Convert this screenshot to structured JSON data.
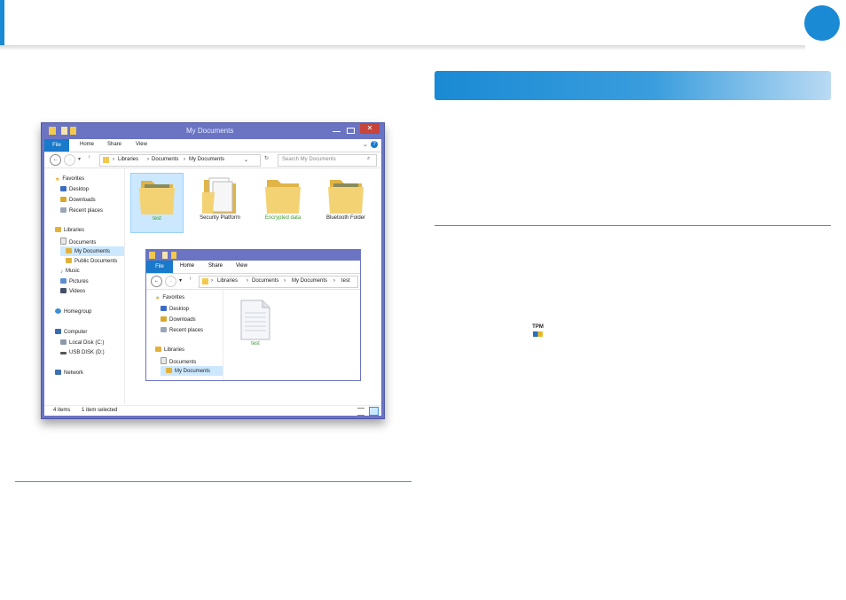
{
  "colors": {
    "accent": "#1a8ad4",
    "window_frame": "#6a74c3",
    "selected": "#cce8ff",
    "green_label": "#3c9a2e"
  },
  "explorer": {
    "title": "My Documents",
    "ribbon": {
      "file": "File",
      "home": "Home",
      "share": "Share",
      "view": "View"
    },
    "address": {
      "libraries": "Libraries",
      "documents": "Documents",
      "mydocs": "My Documents"
    },
    "search_placeholder": "Search My Documents",
    "nav": {
      "favorites": "Favorites",
      "desktop": "Desktop",
      "downloads": "Downloads",
      "recent": "Recent places",
      "libraries": "Libraries",
      "documents": "Documents",
      "mydocs": "My Documents",
      "publicdocs": "Public Documents",
      "music": "Music",
      "pictures": "Pictures",
      "videos": "Videos",
      "homegroup": "Homegroup",
      "computer": "Computer",
      "localdisk": "Local Disk (C:)",
      "usb": "USB DISK (D:)",
      "network": "Network"
    },
    "folders": [
      {
        "label": "test"
      },
      {
        "label": "Security Platform"
      },
      {
        "label": "Encrypted data"
      },
      {
        "label": "Bluetooth Folder"
      }
    ],
    "status": {
      "items": "4 items",
      "selected": "1 item selected"
    }
  },
  "inner_explorer": {
    "ribbon": {
      "file": "File",
      "home": "Home",
      "share": "Share",
      "view": "View"
    },
    "address": {
      "libraries": "Libraries",
      "documents": "Documents",
      "mydocs": "My Documents",
      "test": "test"
    },
    "nav": {
      "favorites": "Favorites",
      "desktop": "Desktop",
      "downloads": "Downloads",
      "recent": "Recent places",
      "libraries": "Libraries",
      "documents": "Documents",
      "mydocs": "My Documents"
    },
    "file_label": "test"
  }
}
